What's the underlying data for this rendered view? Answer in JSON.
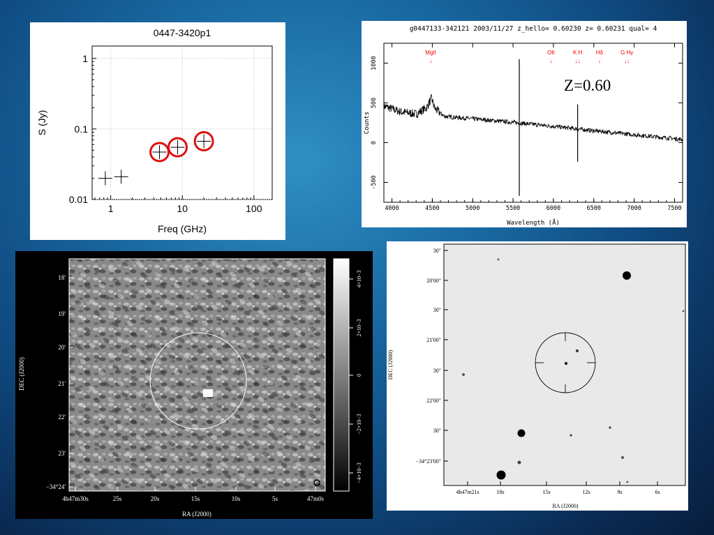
{
  "chart_data": [
    {
      "type": "scatter",
      "title": "0447-3420p1",
      "xlabel": "Freq (GHz)",
      "ylabel": "S (Jy)",
      "xscale": "log",
      "yscale": "log",
      "xlim": [
        0.55,
        180
      ],
      "ylim": [
        0.01,
        1.5
      ],
      "xticks": [
        "1",
        "10",
        "100"
      ],
      "yticks": [
        "1",
        "0.1",
        "0.01"
      ],
      "grid": "dotted",
      "series": [
        {
          "x": [
            0.84,
            1.4
          ],
          "y": [
            0.02,
            0.021
          ],
          "marker": "cross",
          "color": "#000000"
        },
        {
          "x": [
            4.8,
            8.6,
            20
          ],
          "y": [
            0.047,
            0.055,
            0.067
          ],
          "marker": "cross-circled",
          "color": "#dd1111"
        }
      ]
    },
    {
      "type": "line",
      "title": "g0447133-342121 2003/11/27 z_hello= 0.60230 z= 0.60231 qual= 4",
      "xlabel": "Wavelength (Å)",
      "ylabel": "Counts",
      "xlim": [
        3900,
        7600
      ],
      "ylim": [
        -750,
        1250
      ],
      "xticks": [
        "4000",
        "4500",
        "5000",
        "5500",
        "6000",
        "6500",
        "7000",
        "7500"
      ],
      "yticks": [
        "-500",
        "0",
        "500",
        "1000"
      ],
      "lines": [
        {
          "label": "MgII",
          "x": 4480
        },
        {
          "label": "OII",
          "x": 5970
        },
        {
          "label": "K H",
          "x": 6300
        },
        {
          "label": "Hδ",
          "x": 6570
        },
        {
          "label": "G Hγ",
          "x": 6910
        }
      ],
      "line_color": "#ee0000",
      "arrows": [
        "↓",
        "↓",
        "↓↓",
        "↓",
        "↓↓"
      ],
      "continuum": [
        [
          3900,
          460
        ],
        [
          4100,
          390
        ],
        [
          4300,
          360
        ],
        [
          4430,
          440
        ],
        [
          4490,
          560
        ],
        [
          4530,
          430
        ],
        [
          4650,
          330
        ],
        [
          5000,
          300
        ],
        [
          5500,
          255
        ],
        [
          6000,
          205
        ],
        [
          6500,
          150
        ],
        [
          7000,
          100
        ],
        [
          7600,
          40
        ]
      ],
      "spikes": [
        {
          "x": 5577,
          "top": 1050,
          "bottom": -670
        },
        {
          "x": 6300,
          "top": 480,
          "bottom": -240
        }
      ],
      "annotation": "Z=0.60"
    },
    {
      "type": "heatmap",
      "xlabel": "RA (J2000)",
      "ylabel": "DEC (J2000)",
      "xticks": [
        "4h47m30s",
        "25s",
        "20s",
        "15s",
        "10s",
        "5s",
        "47m0s"
      ],
      "yticks": [
        "18'",
        "19'",
        "20'",
        "21'",
        "22'",
        "23'",
        "−34°24'"
      ],
      "colorbar_ticks": [
        "4×10−3",
        "2×10−3",
        "0",
        "−2×10−3",
        "−4×10−3"
      ],
      "colormap": "gray"
    },
    {
      "type": "scatter",
      "xlabel": "RA (J2000)",
      "ylabel": "DEC (J2000)",
      "xticks": [
        "4h47m21s",
        "18s",
        "15s",
        "12s",
        "9s",
        "6s"
      ],
      "yticks": [
        "30\"",
        "20'00\"",
        "30\"",
        "21'00\"",
        "30\"",
        "22'00\"",
        "30\"",
        "−34°23'00\""
      ]
    }
  ],
  "labels": {
    "sed_title": "0447-3420p1",
    "sed_xlabel": "Freq (GHz)",
    "sed_ylabel": "S (Jy)",
    "spec_title": "g0447133-342121 2003/11/27 z_hello= 0.60230 z= 0.60231 qual= 4",
    "spec_xlabel": "Wavelength (Å)",
    "spec_ylabel": "Counts",
    "spec_annotation": "Z=0.60",
    "radio_xlabel": "RA (J2000)",
    "radio_ylabel": "DEC (J2000)",
    "opt_xlabel": "RA (J2000)",
    "opt_ylabel": "DEC (J2000)"
  }
}
